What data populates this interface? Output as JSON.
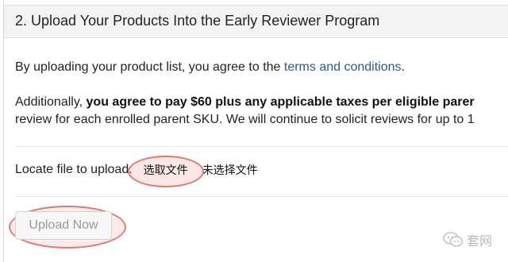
{
  "section": {
    "title": "2. Upload Your Products Into the Early Reviewer Program"
  },
  "agreement": {
    "prefix": "By uploading your product list, you agree to the ",
    "link": "terms and conditions",
    "suffix": "."
  },
  "additional": {
    "lead": "Additionally, ",
    "bold": "you agree to pay $60 plus any applicable taxes per eligible parer",
    "line2": "review for each enrolled parent SKU. We will continue to solicit reviews for up to 1"
  },
  "locate": {
    "label": "Locate file to upload:",
    "choose_file": "选取文件",
    "no_file": "未选择文件"
  },
  "upload": {
    "button_label": "Upload Now"
  },
  "watermark": {
    "text": "套网",
    "icon": "wechat-icon"
  },
  "colors": {
    "link": "#2a5a8f",
    "highlight_ring": "#e07a74",
    "header_bg": "#f3f3f3"
  }
}
